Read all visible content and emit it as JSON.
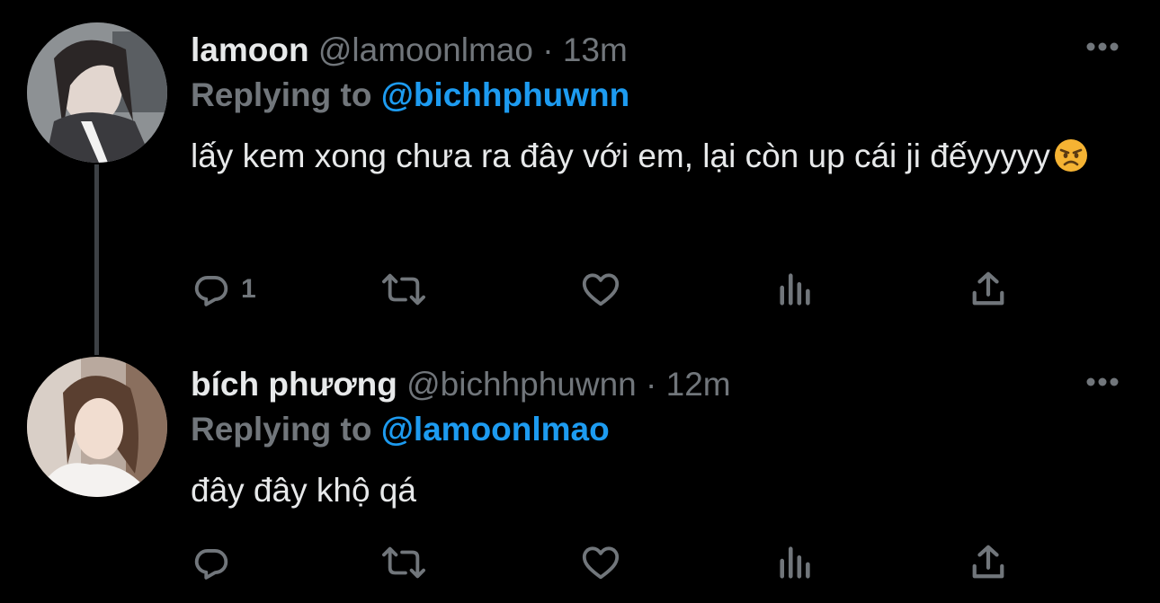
{
  "tweets": [
    {
      "display_name": "lamoon",
      "handle": "@lamoonlmao",
      "dot": "·",
      "time": "13m",
      "replying_prefix": "Replying to",
      "replying_to": "@bichhphuwnn",
      "text": "lấy kem xong chưa ra đây với em, lại còn up cái ji đếyyyyy",
      "emoji": "angry-face-emoji",
      "reply_count": "1",
      "icons": [
        "reply-icon",
        "retweet-icon",
        "like-icon",
        "views-icon",
        "share-icon"
      ]
    },
    {
      "display_name": "bích phương",
      "handle": "@bichhphuwnn",
      "dot": "·",
      "time": "12m",
      "replying_prefix": "Replying to",
      "replying_to": "@lamoonlmao",
      "text": "đây đây khộ qá",
      "reply_count": "",
      "icons": [
        "reply-icon",
        "retweet-icon",
        "like-icon",
        "views-icon",
        "share-icon"
      ]
    }
  ],
  "colors": {
    "background": "#000000",
    "text": "#e7e9ea",
    "secondary": "#71767b",
    "mention": "#1d9bf0",
    "thread_line": "#3d4145"
  }
}
